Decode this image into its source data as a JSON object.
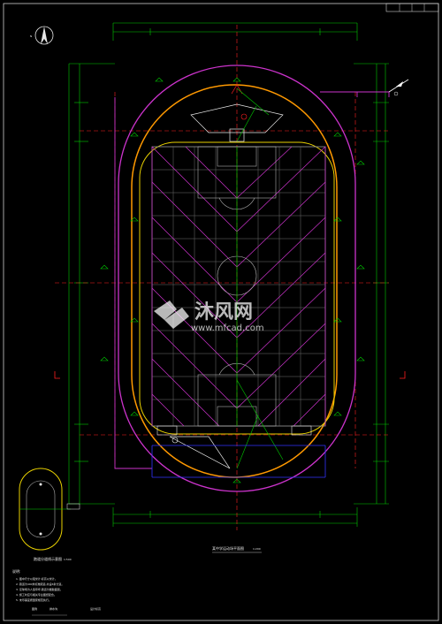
{
  "titleblock": {
    "cell_a": "",
    "cell_b": "",
    "cell_c": ""
  },
  "drawing": {
    "main_title": "某中学运动场平面图",
    "main_scale": "1:200",
    "detail_title": "跑道分道线示意图",
    "detail_scale": "1:500",
    "north_label": "N"
  },
  "notes": {
    "heading": "说明:",
    "lines": [
      "1. 图中尺寸以毫米计,标高以米计。",
      "2. 跑道为400米标准跑道,共设6条分道。",
      "3. 足球场为人造草坪,跑道为塑胶面层。",
      "4. 施工时应与相关专业图纸配合。",
      "5. 未尽事宜按国家规范执行。"
    ],
    "legend_a": "图例",
    "legend_b": "排水沟",
    "legend_c": "设计标高"
  },
  "watermark": {
    "brand": "沐风网",
    "url": "www.mfcad.com"
  },
  "colors": {
    "background": "#000000",
    "magenta": "#cc33cc",
    "yellow": "#e8d000",
    "green": "#00cc00",
    "red": "#ff0000",
    "white": "#e8e8e8",
    "blue": "#3333ff",
    "orange": "#ff8800"
  }
}
